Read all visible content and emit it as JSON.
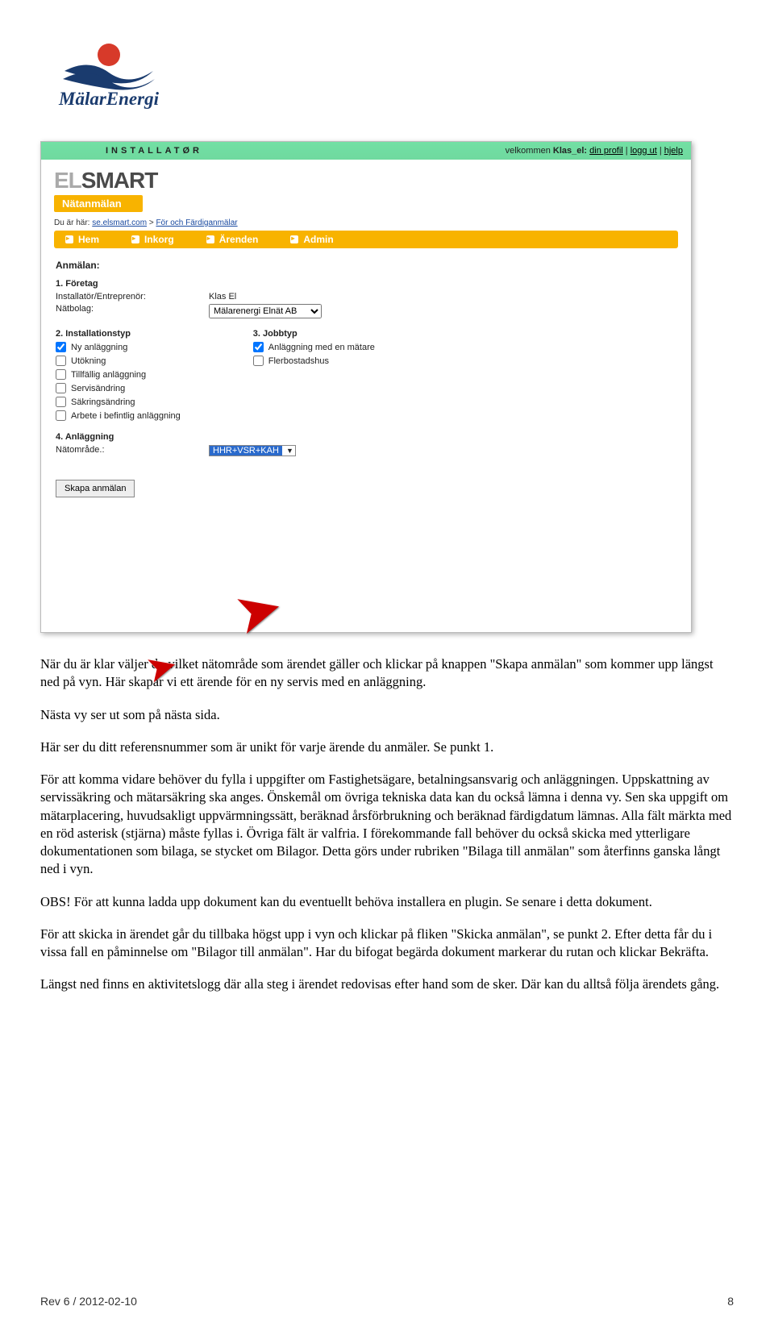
{
  "logo_text": "MälarEnergi",
  "screenshot": {
    "header": {
      "role": "INSTALLATØR",
      "welcome_prefix": "velkommen ",
      "welcome_name": "Klas_el:",
      "links": {
        "profile": "din profil",
        "logout": "logg ut",
        "help": "hjelp"
      }
    },
    "brand": {
      "el": "EL",
      "smart": "SMART",
      "sub": "Nätanmälan"
    },
    "crumb_prefix": "Du är här: ",
    "crumb_link1": "se.elsmart.com",
    "crumb_sep": " > ",
    "crumb_link2": "För och Färdiganmälar",
    "tabs": [
      "Hem",
      "Inkorg",
      "Ärenden",
      "Admin"
    ],
    "form": {
      "title": "Anmälan:",
      "sec1": "1. Företag",
      "installer_label": "Installatör/Entreprenör:",
      "installer_value": "Klas El",
      "natbolag_label": "Nätbolag:",
      "natbolag_value": "Mälarenergi Elnät AB",
      "sec2": "2. Installationstyp",
      "sec3": "3. Jobbtyp",
      "install_types": [
        {
          "label": "Ny anläggning",
          "checked": true
        },
        {
          "label": "Utökning",
          "checked": false
        },
        {
          "label": "Tillfällig anläggning",
          "checked": false
        },
        {
          "label": "Servisändring",
          "checked": false
        },
        {
          "label": "Säkringsändring",
          "checked": false
        },
        {
          "label": "Arbete i befintlig anläggning",
          "checked": false
        }
      ],
      "job_types": [
        {
          "label": "Anläggning med en mätare",
          "checked": true
        },
        {
          "label": "Flerbostadshus",
          "checked": false
        }
      ],
      "sec4": "4. Anläggning",
      "natomrade_label": "Nätområde.:",
      "natomrade_value": "HHR+VSR+KAH",
      "button": "Skapa anmälan"
    }
  },
  "paragraphs": {
    "p1": "När du är klar väljer du vilket nätområde som ärendet gäller och klickar på knappen \"Skapa anmälan\" som kommer upp längst ned på vyn. Här skapar vi ett ärende för en ny servis med en anläggning.",
    "p2": "Nästa vy ser ut som på nästa sida.",
    "p3": "Här ser du ditt referensnummer som är unikt för varje ärende du anmäler. Se punkt 1.",
    "p4": "För att komma vidare behöver du fylla i uppgifter om Fastighetsägare, betalningsansvarig och anläggningen. Uppskattning av servissäkring och mätarsäkring ska anges. Önskemål om övriga tekniska data kan du också lämna i denna vy. Sen ska uppgift om mätarplacering, huvudsakligt uppvärmningssätt, beräknad årsförbrukning och beräknad färdigdatum lämnas. Alla fält märkta med en röd asterisk (stjärna) måste fyllas i. Övriga fält är valfria. I förekommande fall behöver du också skicka med ytterligare dokumentationen som bilaga, se stycket om Bilagor. Detta görs under rubriken \"Bilaga till anmälan\" som återfinns ganska långt ned i vyn.",
    "p5": "OBS! För att kunna ladda upp dokument kan du eventuellt behöva installera en plugin. Se senare i detta dokument.",
    "p6": "För att skicka in ärendet går du tillbaka högst upp i vyn och klickar på fliken \"Skicka anmälan\", se punkt 2. Efter detta får du i vissa fall en påminnelse om \"Bilagor till anmälan\". Har du bifogat begärda dokument markerar du rutan och klickar Bekräfta.",
    "p7": "Längst ned finns en aktivitetslogg där alla steg i ärendet redovisas efter hand som de sker. Där kan du alltså följa ärendets gång."
  },
  "footer": {
    "rev": "Rev 6 / 2012-02-10",
    "page": "8"
  }
}
